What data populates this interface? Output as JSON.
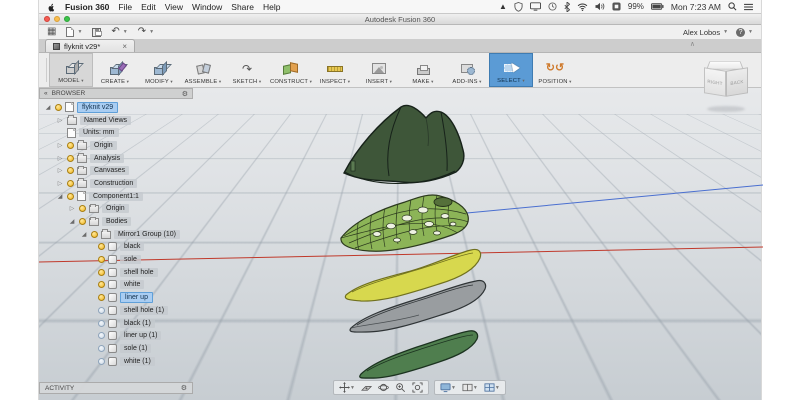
{
  "menubar": {
    "app_menu": "Fusion 360",
    "menus": [
      "File",
      "Edit",
      "View",
      "Window",
      "Share",
      "Help"
    ],
    "battery": "99%",
    "clock": "Mon 7:23 AM"
  },
  "window": {
    "title": "Autodesk Fusion 360"
  },
  "quick_toolbar": {
    "user": "Alex Lobos",
    "help": "?"
  },
  "tabs": {
    "active": "flyknit v29*"
  },
  "ribbon": {
    "items": [
      {
        "label": "MODEL"
      },
      {
        "label": "CREATE"
      },
      {
        "label": "MODIFY"
      },
      {
        "label": "ASSEMBLE"
      },
      {
        "label": "SKETCH"
      },
      {
        "label": "CONSTRUCT"
      },
      {
        "label": "INSPECT"
      },
      {
        "label": "INSERT"
      },
      {
        "label": "MAKE"
      },
      {
        "label": "ADD-INS"
      },
      {
        "label": "SELECT"
      },
      {
        "label": "POSITION"
      }
    ]
  },
  "browser": {
    "title": "BROWSER",
    "tree": [
      {
        "label": "flyknit v29",
        "selected": true,
        "visible": true
      },
      {
        "label": "Named Views"
      },
      {
        "label": "Units: mm"
      },
      {
        "label": "Origin",
        "visible": true
      },
      {
        "label": "Analysis",
        "visible": true
      },
      {
        "label": "Canvases",
        "visible": true
      },
      {
        "label": "Construction",
        "visible": true
      },
      {
        "label": "Component1:1",
        "visible": true
      },
      {
        "label": "Origin",
        "visible": true
      },
      {
        "label": "Bodies",
        "visible": true
      },
      {
        "label": "Mirror1 Group (10)",
        "visible": true
      },
      {
        "label": "black",
        "visible": true
      },
      {
        "label": "sole",
        "visible": true
      },
      {
        "label": "shell hole",
        "visible": true
      },
      {
        "label": "white",
        "visible": true
      },
      {
        "label": "liner up",
        "selected": true,
        "visible": true
      },
      {
        "label": "shell hole (1)",
        "visible": false
      },
      {
        "label": "black (1)",
        "visible": false
      },
      {
        "label": "liner up (1)",
        "visible": false
      },
      {
        "label": "sole (1)",
        "visible": false
      },
      {
        "label": "white (1)",
        "visible": false
      }
    ]
  },
  "activity": {
    "label": "ACTIVITY"
  },
  "viewcube": {
    "left_face": "RIGHT",
    "right_face": "BACK"
  },
  "colors": {
    "accent": "#5b9bd5",
    "selection": "#a9cdf2",
    "shoe_last": "#3e5639",
    "mesh_upper": "#8cb457",
    "liner": "#d7d84e",
    "midsole": "#9a9a9a",
    "outsole": "#4f7e4e",
    "axis_red": "#c0392b",
    "axis_blue": "#4a6fd0"
  }
}
